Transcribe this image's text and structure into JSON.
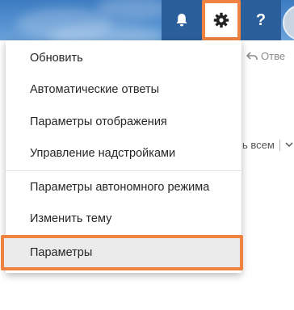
{
  "header": {
    "bell_icon": "bell-icon",
    "gear_icon": "gear-icon",
    "help_label": "?",
    "avatar": "avatar"
  },
  "background": {
    "reply_label": "Отве",
    "reply_all_label": "ь всем"
  },
  "settings_menu": {
    "items": [
      {
        "label": "Обновить"
      },
      {
        "label": "Автоматические ответы"
      },
      {
        "label": "Параметры отображения"
      },
      {
        "label": "Управление надстройками"
      },
      {
        "label": "Параметры автономного режима"
      },
      {
        "label": "Изменить тему"
      },
      {
        "label": "Параметры",
        "highlighted": true
      }
    ]
  },
  "colors": {
    "header_blue": "#4a87c9",
    "header_button_dark": "#2b5f9b",
    "highlight_orange": "#f08341",
    "menu_hover_gray": "#ebebeb"
  }
}
